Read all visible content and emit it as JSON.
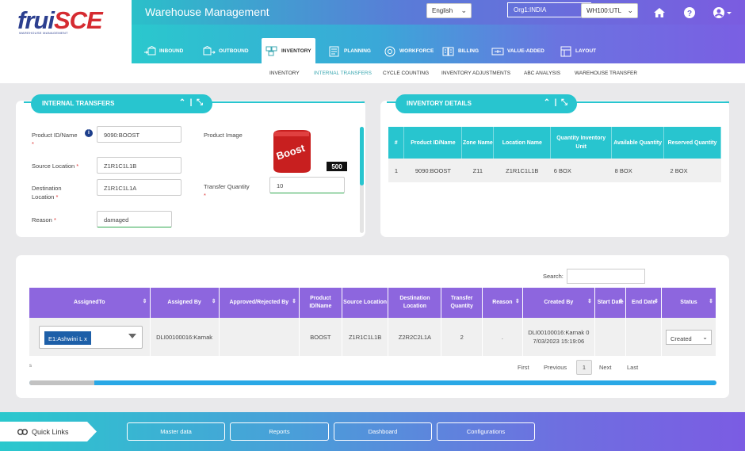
{
  "brand": {
    "logo_main": "fruisce",
    "logo_accent": "SCE",
    "tagline": "WAREHOUSE MANAGEMENT"
  },
  "header": {
    "title": "Warehouse Management",
    "language": "English",
    "org": "Org1:INDIA",
    "warehouse": "WH100:UTL",
    "icons": [
      "home-icon",
      "help-icon",
      "user-icon"
    ]
  },
  "nav": {
    "tabs": [
      {
        "label": "INBOUND",
        "icon": "truck-in-icon"
      },
      {
        "label": "OUTBOUND",
        "icon": "truck-out-icon"
      },
      {
        "label": "INVENTORY",
        "icon": "inventory-icon",
        "active": true
      },
      {
        "label": "PLANNING",
        "icon": "planning-icon"
      },
      {
        "label": "WORKFORCE",
        "icon": "workforce-icon"
      },
      {
        "label": "BILLING",
        "icon": "billing-icon"
      },
      {
        "label": "VALUE-ADDED",
        "icon": "value-added-icon"
      },
      {
        "label": "LAYOUT",
        "icon": "layout-icon"
      }
    ]
  },
  "submenu": {
    "items": [
      {
        "label": "INVENTORY"
      },
      {
        "label": "INTERNAL TRANSFERS",
        "active": true
      },
      {
        "label": "CYCLE COUNTING"
      },
      {
        "label": "INVENTORY ADJUSTMENTS"
      },
      {
        "label": "ABC ANALYSIS"
      },
      {
        "label": "WAREHOUSE TRANSFER"
      }
    ]
  },
  "transfer_form": {
    "title": "INTERNAL TRANSFERS",
    "product_label": "Product ID/Name",
    "product_value": "9090:BOOST",
    "image_label": "Product Image",
    "image_badge": "500",
    "product_brand": "Boost",
    "source_label": "Source Location",
    "source_value": "Z1R1C1L1B",
    "dest_label_1": "Destination",
    "dest_label_2": "Location",
    "dest_value": "Z1R1C1L1A",
    "qty_label": "Transfer Quantity",
    "qty_value": "10",
    "reason_label": "Reason",
    "reason_value": "damaged",
    "required_mark": "*"
  },
  "inventory_details": {
    "title": "INVENTORY DETAILS",
    "headers": [
      "#",
      "Product ID/Name",
      "Zone Name",
      "Location Name",
      "Quantity Inventory Unit",
      "Available Quantity",
      "Reserved Quantity"
    ],
    "rows": [
      [
        "1",
        "9090:BOOST",
        "Z11",
        "Z1R1C1L1B",
        "6 BOX",
        "8 BOX",
        "2 BOX"
      ]
    ]
  },
  "transfers_table": {
    "search_label": "Search:",
    "headers": [
      "AssignedTo",
      "Assigned By",
      "Approved/Rejected By",
      "Product ID/Name",
      "Source Location",
      "Destination Location",
      "Transfer Quantity",
      "Reason",
      "Created By",
      "Start Date",
      "End Date",
      "Status"
    ],
    "row": {
      "assigned_to": "E1:Ashwini L",
      "chip_remove": "x",
      "assigned_by": "DLI00100016:Karnak",
      "approved_by": "",
      "product": "BOOST",
      "source": "Z1R1C1L1B",
      "destination": "Z2R2C2L1A",
      "quantity": "2",
      "reason": ".",
      "created_by": "DLI00100016:Karnak 07/03/2023 15:19:06",
      "start_date": "",
      "end_date": "",
      "status": "Created"
    },
    "info_mark": "s",
    "pagination": {
      "first": "First",
      "previous": "Previous",
      "current": "1",
      "next": "Next",
      "last": "Last"
    }
  },
  "footer": {
    "quick_links": "Quick Links",
    "buttons": [
      "Master data",
      "Reports",
      "Dashboard",
      "Configurations"
    ]
  }
}
